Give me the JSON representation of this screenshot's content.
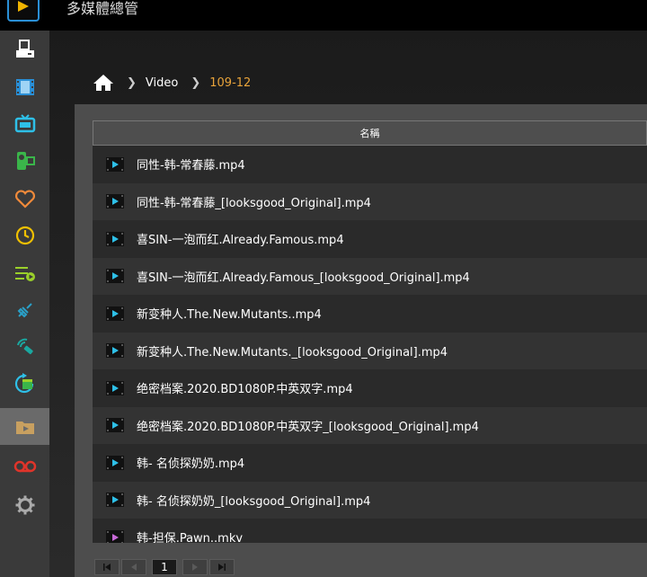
{
  "app": {
    "title": "多媒體總管"
  },
  "sidebar": {
    "items": [
      {
        "name": "sidebar-item-server",
        "icon": "server-icon"
      },
      {
        "name": "sidebar-item-movies",
        "icon": "film-icon"
      },
      {
        "name": "sidebar-item-tv",
        "icon": "tv-icon"
      },
      {
        "name": "sidebar-item-home-video",
        "icon": "camcorder-icon"
      },
      {
        "name": "sidebar-item-favorites",
        "icon": "heart-icon"
      },
      {
        "name": "sidebar-item-recent",
        "icon": "clock-icon"
      },
      {
        "name": "sidebar-item-playlist",
        "icon": "playlist-icon"
      },
      {
        "name": "sidebar-item-connect",
        "icon": "plug-icon"
      },
      {
        "name": "sidebar-item-remote",
        "icon": "remote-icon"
      },
      {
        "name": "sidebar-item-refresh",
        "icon": "refresh-clapper-icon"
      },
      {
        "name": "sidebar-item-folders",
        "icon": "folder-icon",
        "active": true
      },
      {
        "name": "sidebar-item-recordings",
        "icon": "tape-icon"
      },
      {
        "name": "sidebar-item-settings",
        "icon": "gear-icon"
      }
    ]
  },
  "breadcrumb": {
    "video": "Video",
    "current": "109-12"
  },
  "table": {
    "header": "名稱",
    "rows": [
      {
        "label": "同性-韩-常春藤.mp4",
        "kind": "mp4"
      },
      {
        "label": "同性-韩-常春藤_[looksgood_Original].mp4",
        "kind": "mp4"
      },
      {
        "label": "喜SIN-一泡而红.Already.Famous.mp4",
        "kind": "mp4"
      },
      {
        "label": "喜SIN-一泡而红.Already.Famous_[looksgood_Original].mp4",
        "kind": "mp4"
      },
      {
        "label": "新变种人.The.New.Mutants..mp4",
        "kind": "mp4"
      },
      {
        "label": "新变种人.The.New.Mutants._[looksgood_Original].mp4",
        "kind": "mp4"
      },
      {
        "label": "绝密档案.2020.BD1080P.中英双字.mp4",
        "kind": "mp4"
      },
      {
        "label": "绝密档案.2020.BD1080P.中英双字_[looksgood_Original].mp4",
        "kind": "mp4"
      },
      {
        "label": "韩- 名侦探奶奶.mp4",
        "kind": "mp4"
      },
      {
        "label": "韩- 名侦探奶奶_[looksgood_Original].mp4",
        "kind": "mp4"
      },
      {
        "label": "韩-担保.Pawn..mkv",
        "kind": "mkv"
      }
    ]
  },
  "pager": {
    "page": "1"
  },
  "colors": {
    "accent": "#e8a33a",
    "brand": "#2a8fd6",
    "mp4_icon": "#2ec0e8",
    "mkv_icon": "#c86ad8"
  }
}
